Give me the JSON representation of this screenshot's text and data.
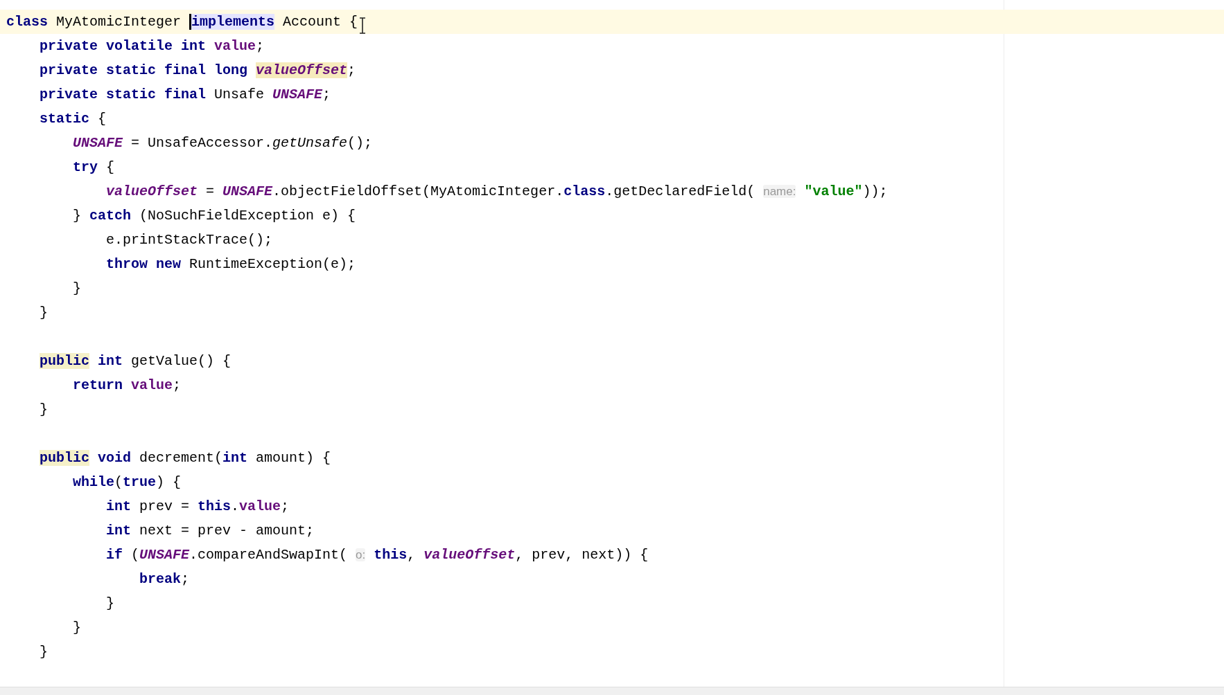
{
  "editor": {
    "lines": [
      {
        "kind": "code",
        "current": true,
        "tokens": [
          {
            "text": "class",
            "kind": "keyword"
          },
          {
            "text": " MyAtomicInteger ",
            "kind": "plain"
          },
          {
            "text": "implements",
            "kind": "keyword",
            "selected": true,
            "caret": true
          },
          {
            "text": " Account {",
            "kind": "plain"
          }
        ],
        "children": [
          {
            "kind": "code",
            "tokens": [
              {
                "text": "private volatile int",
                "kind": "keyword"
              },
              {
                "text": " value",
                "kind": "field"
              },
              {
                "text": ";",
                "kind": "plain"
              }
            ]
          },
          {
            "kind": "code",
            "tokens": [
              {
                "text": "private static final long ",
                "kind": "keyword"
              },
              {
                "text": "valueOffset",
                "kind": "static_field",
                "warning": true
              },
              {
                "text": ";",
                "kind": "plain"
              }
            ]
          },
          {
            "kind": "code",
            "tokens": [
              {
                "text": "private static final",
                "kind": "keyword"
              },
              {
                "text": " Unsafe ",
                "kind": "plain"
              },
              {
                "text": "UNSAFE",
                "kind": "static_field"
              },
              {
                "text": ";",
                "kind": "plain"
              }
            ]
          },
          {
            "kind": "code",
            "tokens": [
              {
                "text": "static",
                "kind": "keyword"
              },
              {
                "text": " {",
                "kind": "plain"
              }
            ],
            "children": [
              {
                "kind": "code",
                "tokens": [
                  {
                    "text": "UNSAFE",
                    "kind": "static_field"
                  },
                  {
                    "text": " = UnsafeAccessor.",
                    "kind": "plain"
                  },
                  {
                    "text": "getUnsafe",
                    "kind": "static_method"
                  },
                  {
                    "text": "();",
                    "kind": "plain"
                  }
                ]
              },
              {
                "kind": "code",
                "tokens": [
                  {
                    "text": "try",
                    "kind": "keyword"
                  },
                  {
                    "text": " {",
                    "kind": "plain"
                  }
                ],
                "children": [
                  {
                    "kind": "code",
                    "tokens": [
                      {
                        "text": "valueOffset",
                        "kind": "static_field"
                      },
                      {
                        "text": " = ",
                        "kind": "plain"
                      },
                      {
                        "text": "UNSAFE",
                        "kind": "static_field"
                      },
                      {
                        "text": ".objectFieldOffset(MyAtomicInteger.",
                        "kind": "plain"
                      },
                      {
                        "text": "class",
                        "kind": "keyword"
                      },
                      {
                        "text": ".getDeclaredField( ",
                        "kind": "plain"
                      },
                      {
                        "text": "name:",
                        "kind": "hint"
                      },
                      {
                        "text": " \"value\"",
                        "kind": "string"
                      },
                      {
                        "text": "));",
                        "kind": "plain"
                      }
                    ]
                  }
                ]
              },
              {
                "kind": "code",
                "tokens": [
                  {
                    "text": "} ",
                    "kind": "plain"
                  },
                  {
                    "text": "catch",
                    "kind": "keyword"
                  },
                  {
                    "text": " (NoSuchFieldException e) {",
                    "kind": "plain"
                  }
                ],
                "children": [
                  {
                    "kind": "code",
                    "tokens": [
                      {
                        "text": "e.printStackTrace();",
                        "kind": "plain"
                      }
                    ]
                  },
                  {
                    "kind": "code",
                    "tokens": [
                      {
                        "text": "throw new",
                        "kind": "keyword"
                      },
                      {
                        "text": " RuntimeException(e);",
                        "kind": "plain"
                      }
                    ]
                  }
                ]
              },
              {
                "kind": "code",
                "tokens": [
                  {
                    "text": "}",
                    "kind": "plain"
                  }
                ]
              }
            ]
          },
          {
            "kind": "code",
            "tokens": [
              {
                "text": "}",
                "kind": "plain"
              }
            ]
          },
          {
            "kind": "blank"
          },
          {
            "kind": "code",
            "tokens": [
              {
                "text": "public",
                "kind": "keyword",
                "usage": true
              },
              {
                "text": " int",
                "kind": "keyword"
              },
              {
                "text": " getValue() {",
                "kind": "plain"
              }
            ],
            "children": [
              {
                "kind": "code",
                "tokens": [
                  {
                    "text": "return",
                    "kind": "keyword"
                  },
                  {
                    "text": " value",
                    "kind": "field"
                  },
                  {
                    "text": ";",
                    "kind": "plain"
                  }
                ]
              }
            ]
          },
          {
            "kind": "code",
            "tokens": [
              {
                "text": "}",
                "kind": "plain"
              }
            ]
          },
          {
            "kind": "blank"
          },
          {
            "kind": "code",
            "tokens": [
              {
                "text": "public",
                "kind": "keyword",
                "usage": true
              },
              {
                "text": " void",
                "kind": "keyword"
              },
              {
                "text": " decrement(",
                "kind": "plain"
              },
              {
                "text": "int",
                "kind": "keyword"
              },
              {
                "text": " amount) {",
                "kind": "plain"
              }
            ],
            "children": [
              {
                "kind": "code",
                "tokens": [
                  {
                    "text": "while",
                    "kind": "keyword"
                  },
                  {
                    "text": "(",
                    "kind": "plain"
                  },
                  {
                    "text": "true",
                    "kind": "keyword"
                  },
                  {
                    "text": ") {",
                    "kind": "plain"
                  }
                ],
                "children": [
                  {
                    "kind": "code",
                    "tokens": [
                      {
                        "text": "int",
                        "kind": "keyword"
                      },
                      {
                        "text": " prev = ",
                        "kind": "plain"
                      },
                      {
                        "text": "this",
                        "kind": "keyword"
                      },
                      {
                        "text": ".",
                        "kind": "plain"
                      },
                      {
                        "text": "value",
                        "kind": "field"
                      },
                      {
                        "text": ";",
                        "kind": "plain"
                      }
                    ]
                  },
                  {
                    "kind": "code",
                    "tokens": [
                      {
                        "text": "int",
                        "kind": "keyword"
                      },
                      {
                        "text": " next = prev - amount;",
                        "kind": "plain"
                      }
                    ]
                  },
                  {
                    "kind": "code",
                    "tokens": [
                      {
                        "text": "if",
                        "kind": "keyword"
                      },
                      {
                        "text": " (",
                        "kind": "plain"
                      },
                      {
                        "text": "UNSAFE",
                        "kind": "static_field"
                      },
                      {
                        "text": ".compareAndSwapInt( ",
                        "kind": "plain"
                      },
                      {
                        "text": "o:",
                        "kind": "hint"
                      },
                      {
                        "text": " this",
                        "kind": "keyword"
                      },
                      {
                        "text": ", ",
                        "kind": "plain"
                      },
                      {
                        "text": "valueOffset",
                        "kind": "static_field"
                      },
                      {
                        "text": ", prev, next)) {",
                        "kind": "plain"
                      }
                    ],
                    "children": [
                      {
                        "kind": "code",
                        "tokens": [
                          {
                            "text": "break",
                            "kind": "keyword"
                          },
                          {
                            "text": ";",
                            "kind": "plain"
                          }
                        ]
                      }
                    ]
                  },
                  {
                    "kind": "code",
                    "tokens": [
                      {
                        "text": "}",
                        "kind": "plain"
                      }
                    ]
                  }
                ]
              },
              {
                "kind": "code",
                "tokens": [
                  {
                    "text": "}",
                    "kind": "plain"
                  }
                ]
              }
            ]
          },
          {
            "kind": "code",
            "tokens": [
              {
                "text": "}",
                "kind": "plain"
              }
            ]
          }
        ]
      }
    ]
  }
}
